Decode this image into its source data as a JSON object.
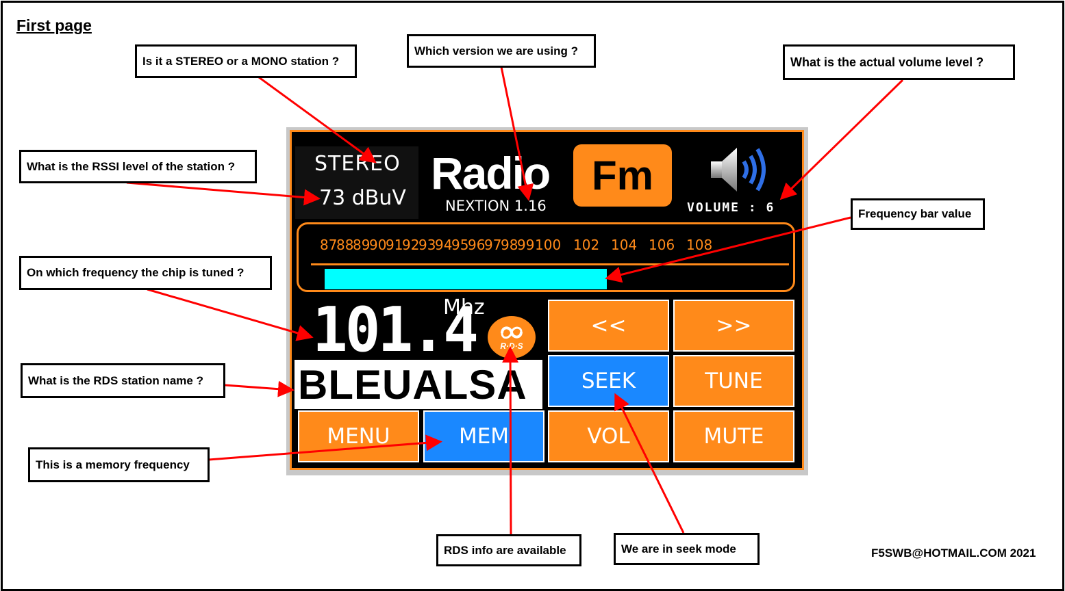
{
  "page_title": "First page",
  "credit": "F5SWB@HOTMAIL.COM 2021",
  "callouts": {
    "stereo": "Is it a STEREO or a MONO station ?",
    "version": "Which version we are using ?",
    "volume": "What is the actual volume level ?",
    "rssi": "What is the RSSI level of the station ?",
    "freq_bar": "Frequency bar value",
    "tuned": "On which frequency the chip is tuned ?",
    "rds_name": "What is the RDS station name ?",
    "memory": "This is a memory frequency",
    "rds_info": "RDS info are available",
    "seek": "We are in seek mode"
  },
  "radio": {
    "stereo_mode": "STEREO",
    "rssi": "73 dBuV",
    "logo_text": "Radio",
    "band": "Fm",
    "version": "NEXTION 1.16",
    "volume_label": "VOLUME : 6",
    "frequency": "101.4",
    "unit": "Mhz",
    "rds_badge": "R·D·S",
    "station_name": "BLEUALSA",
    "frequency_bar_level": 0.62,
    "scale_ticks": [
      "87",
      "88",
      "89",
      "90",
      "91",
      "92",
      "93",
      "94",
      "95",
      "96",
      "97",
      "98",
      "99",
      "100",
      "102",
      "104",
      "106",
      "108"
    ],
    "buttons": {
      "prev": "<<",
      "next": ">>",
      "seek": "SEEK",
      "tune": "TUNE",
      "menu": "MENU",
      "mem": "MEM",
      "vol": "VOL",
      "mute": "MUTE"
    }
  },
  "colors": {
    "accent_orange": "#ff8a1a",
    "active_blue": "#1a88ff",
    "frequency_bar": "#00ffff",
    "arrow_red": "#ff0000"
  },
  "icons": {
    "speaker": "speaker-volume-icon",
    "rds": "rds-logo-icon"
  }
}
